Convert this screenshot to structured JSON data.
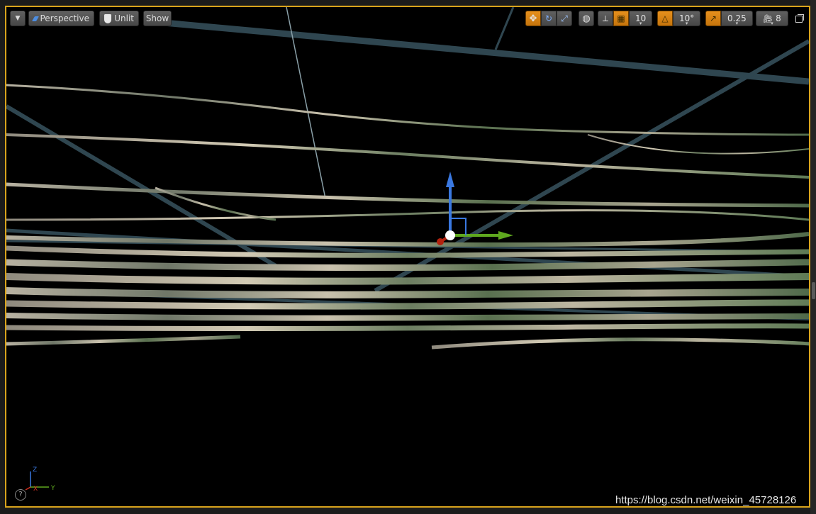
{
  "viewport": {
    "view_mode": "Perspective",
    "lighting_mode": "Unlit",
    "show_label": "Show",
    "grid_snap_value": "10",
    "rotation_snap_value": "10°",
    "scale_snap_value": "0.25",
    "camera_speed": "8",
    "icons": {
      "options_menu": "chevron-down-icon",
      "translate_tool": "move-arrows-icon",
      "rotate_tool": "rotate-icon",
      "scale_tool": "scale-icon",
      "coordinate_space": "globe-icon",
      "surface_snapping": "surface-snap-icon",
      "grid_snap": "grid-icon",
      "rotation_snap": "triangle-angle-icon",
      "scale_snap": "diagonal-arrow-icon",
      "camera_speed": "camera-icon",
      "maximize": "maximize-icon"
    },
    "accent_color": "#d8a31c",
    "active_toggle_color": "#e08a17"
  },
  "axis_indicator": {
    "z_label": "Z",
    "x_label": "X",
    "y_label": "Y"
  },
  "help_icon_glyph": "?",
  "watermark": "https://blog.csdn.net/weixin_45728126"
}
